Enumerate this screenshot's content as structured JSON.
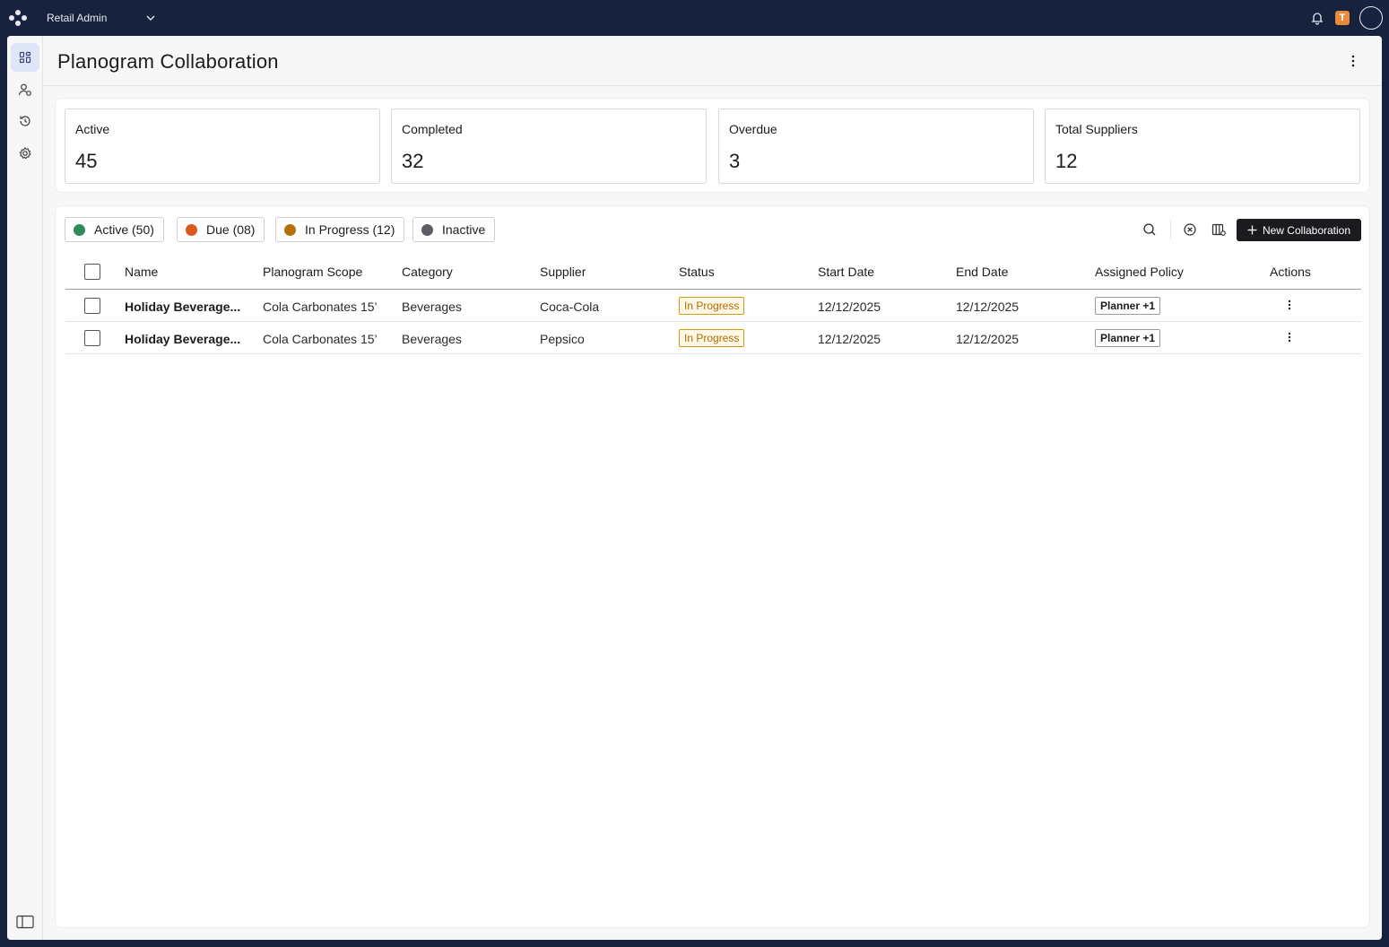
{
  "topbar": {
    "org_name": "Retail Admin",
    "notification_badge": "T"
  },
  "sidebar": {
    "items": [
      {
        "icon": "dashboard-icon",
        "active": true
      },
      {
        "icon": "users-settings-icon",
        "active": false
      },
      {
        "icon": "history-icon",
        "active": false
      },
      {
        "icon": "gear-icon",
        "active": false
      }
    ]
  },
  "page": {
    "title": "Planogram Collaboration"
  },
  "stats": [
    {
      "label": "Active",
      "value": "45"
    },
    {
      "label": "Completed",
      "value": "32"
    },
    {
      "label": "Overdue",
      "value": "3"
    },
    {
      "label": "Total Suppliers",
      "value": "12"
    }
  ],
  "filters": [
    {
      "label": "Active (50)",
      "color": "#2e8a5c"
    },
    {
      "label": "Due (08)",
      "color": "#d9591c"
    },
    {
      "label": "In Progress (12)",
      "color": "#b5700a"
    },
    {
      "label": "Inactive",
      "color": "#5c5c63"
    }
  ],
  "toolbar": {
    "new_label": "New Collaboration"
  },
  "table": {
    "columns": [
      "Name",
      "Planogram Scope",
      "Category",
      "Supplier",
      "Status",
      "Start Date",
      "End Date",
      "Assigned Policy",
      "Actions"
    ],
    "rows": [
      {
        "name": "Holiday Beverage...",
        "scope": "Cola Carbonates 15’",
        "category": "Beverages",
        "supplier": "Coca-Cola",
        "status": "In Progress",
        "start": "12/12/2025",
        "end": "12/12/2025",
        "policy": "Planner +1"
      },
      {
        "name": "Holiday Beverage...",
        "scope": "Cola Carbonates 15’",
        "category": "Beverages",
        "supplier": "Pepsico",
        "status": "In Progress",
        "start": "12/12/2025",
        "end": "12/12/2025",
        "policy": "Planner +1"
      }
    ]
  }
}
